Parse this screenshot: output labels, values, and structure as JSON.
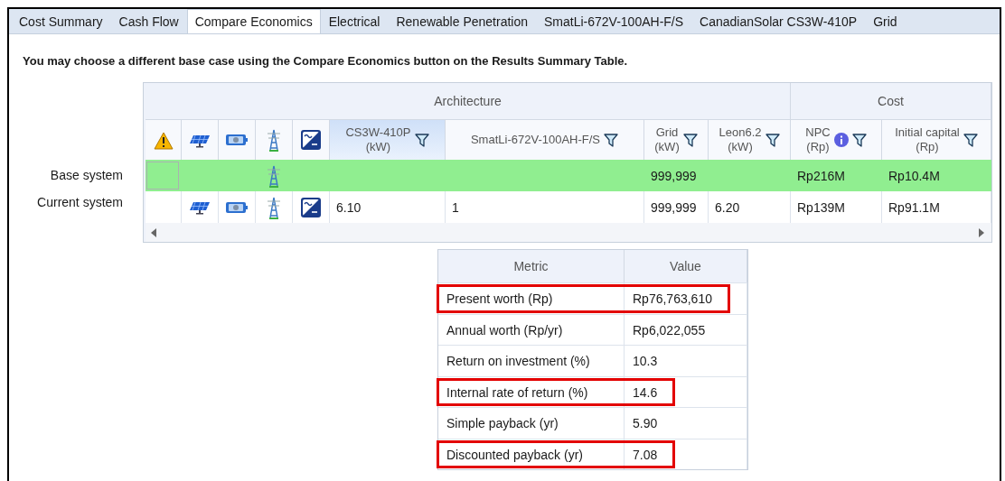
{
  "tabs": [
    {
      "label": "Cost Summary",
      "selected": false
    },
    {
      "label": "Cash Flow",
      "selected": false
    },
    {
      "label": "Compare Economics",
      "selected": true
    },
    {
      "label": "Electrical",
      "selected": false
    },
    {
      "label": "Renewable Penetration",
      "selected": false
    },
    {
      "label": "SmatLi-672V-100AH-F/S",
      "selected": false
    },
    {
      "label": "CanadianSolar CS3W-410P",
      "selected": false
    },
    {
      "label": "Grid",
      "selected": false
    }
  ],
  "notice": "You may choose a different base case using the Compare Economics button on the Results Summary Table.",
  "comparison_grid": {
    "groups": [
      {
        "label": "Architecture",
        "columns": [
          {
            "kind": "icon"
          },
          {
            "kind": "icon"
          },
          {
            "kind": "icon"
          },
          {
            "kind": "icon"
          },
          {
            "kind": "icon"
          },
          {
            "kind": "text",
            "label": "CS3W-410P\n(kW)",
            "filter": true,
            "highlighted": true
          },
          {
            "kind": "text",
            "label": "SmatLi-672V-100AH-F/S",
            "filter": true,
            "highlighted": false
          },
          {
            "kind": "text",
            "label": "Grid\n(kW)",
            "filter": true,
            "highlighted": false
          },
          {
            "kind": "text",
            "label": "Leon6.2\n(kW)",
            "filter": true,
            "highlighted": false
          }
        ]
      },
      {
        "label": "Cost",
        "columns": [
          {
            "kind": "text",
            "label": "NPC\n(Rp)",
            "filter": true,
            "info": true,
            "highlighted": false
          },
          {
            "kind": "text",
            "label": "Initial capital\n(Rp)",
            "filter": true,
            "highlighted": false
          }
        ]
      }
    ],
    "rows": [
      {
        "label": "Base system",
        "highlighted": true,
        "focused": true,
        "cells": [
          false,
          false,
          false,
          true,
          false,
          null,
          null,
          "999,999",
          null,
          "Rp216M",
          "Rp10.4M"
        ]
      },
      {
        "label": "Current system",
        "highlighted": false,
        "focused": false,
        "cells": [
          false,
          true,
          true,
          true,
          true,
          "6.10",
          "1",
          "999,999",
          "6.20",
          "Rp139M",
          "Rp91.1M"
        ]
      }
    ]
  },
  "metrics": {
    "columns": [
      "Metric",
      "Value"
    ],
    "rows": [
      {
        "metric": "Present worth (Rp)",
        "value": "Rp76,763,610",
        "highlighted": true
      },
      {
        "metric": "Annual worth (Rp/yr)",
        "value": "Rp6,022,055",
        "highlighted": false
      },
      {
        "metric": "Return on investment (%)",
        "value": "10.3",
        "highlighted": false
      },
      {
        "metric": "Internal rate of return (%)",
        "value": "14.6",
        "highlighted": true
      },
      {
        "metric": "Simple payback (yr)",
        "value": "5.90",
        "highlighted": false
      },
      {
        "metric": "Discounted payback (yr)",
        "value": "7.08",
        "highlighted": true
      }
    ]
  }
}
